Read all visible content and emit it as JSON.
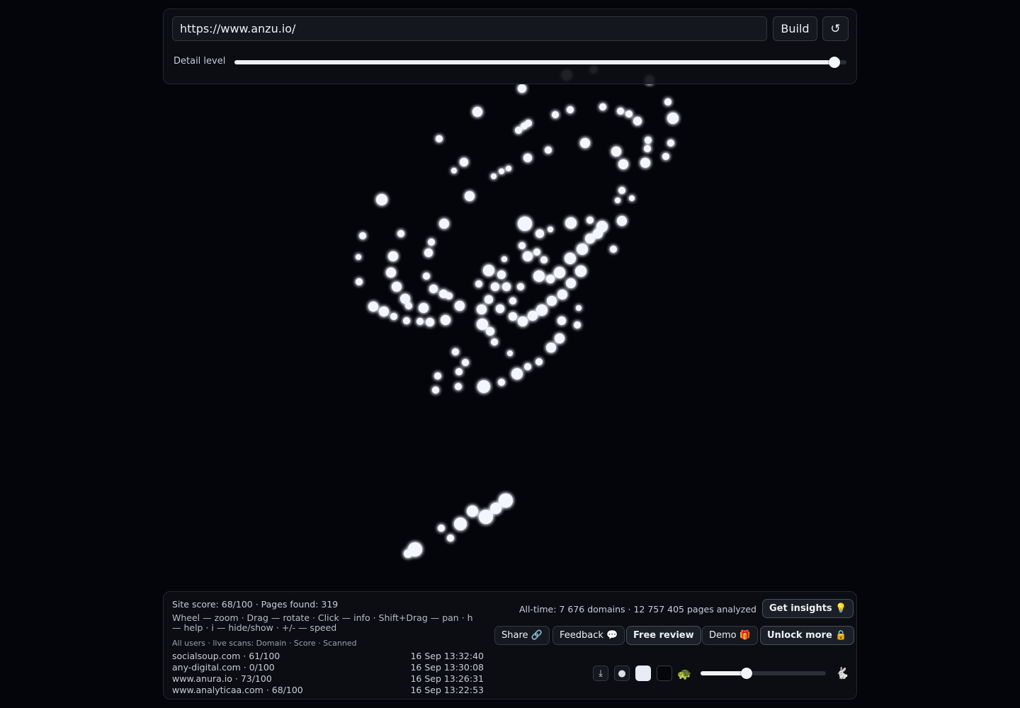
{
  "top_bar": {
    "url_value": "https://www.anzu.io/",
    "build_label": "Build",
    "refresh_icon": "↺",
    "detail_label": "Detail level",
    "detail_level": 0.98
  },
  "bottom_bar": {
    "site_stats": "Site score: 68/100 · Pages found: 319",
    "help_text": "Wheel — zoom · Drag — rotate · Click — info · Shift+Drag — pan · h — help · i — hide/show · +/- — speed",
    "scans_header": "All users · live scans: Domain · Score · Scanned",
    "scans": [
      {
        "domain": "socialsoup.com · 61/100",
        "time": "16 Sep 13:32:40"
      },
      {
        "domain": "any-digital.com · 0/100",
        "time": "16 Sep 13:30:08"
      },
      {
        "domain": "www.anura.io · 73/100",
        "time": "16 Sep 13:26:31"
      },
      {
        "domain": "www.analyticaa.com · 68/100",
        "time": "16 Sep 13:22:53"
      }
    ],
    "alltime_text": "All-time: 7 676 domains · 12 757 405 pages analyzed",
    "insights_label": "Get insights 💡",
    "share_label": "Share 🔗",
    "feedback_label": "Feedback 💬",
    "review_label": "Free review",
    "demo_label": "Demo 🎁",
    "unlock_label": "Unlock more 🔒",
    "download_icon": "⤓",
    "dot_icon": "●",
    "turtle_icon": "🐢",
    "rabbit_icon": "🐇",
    "speed_level": 0.37
  }
}
